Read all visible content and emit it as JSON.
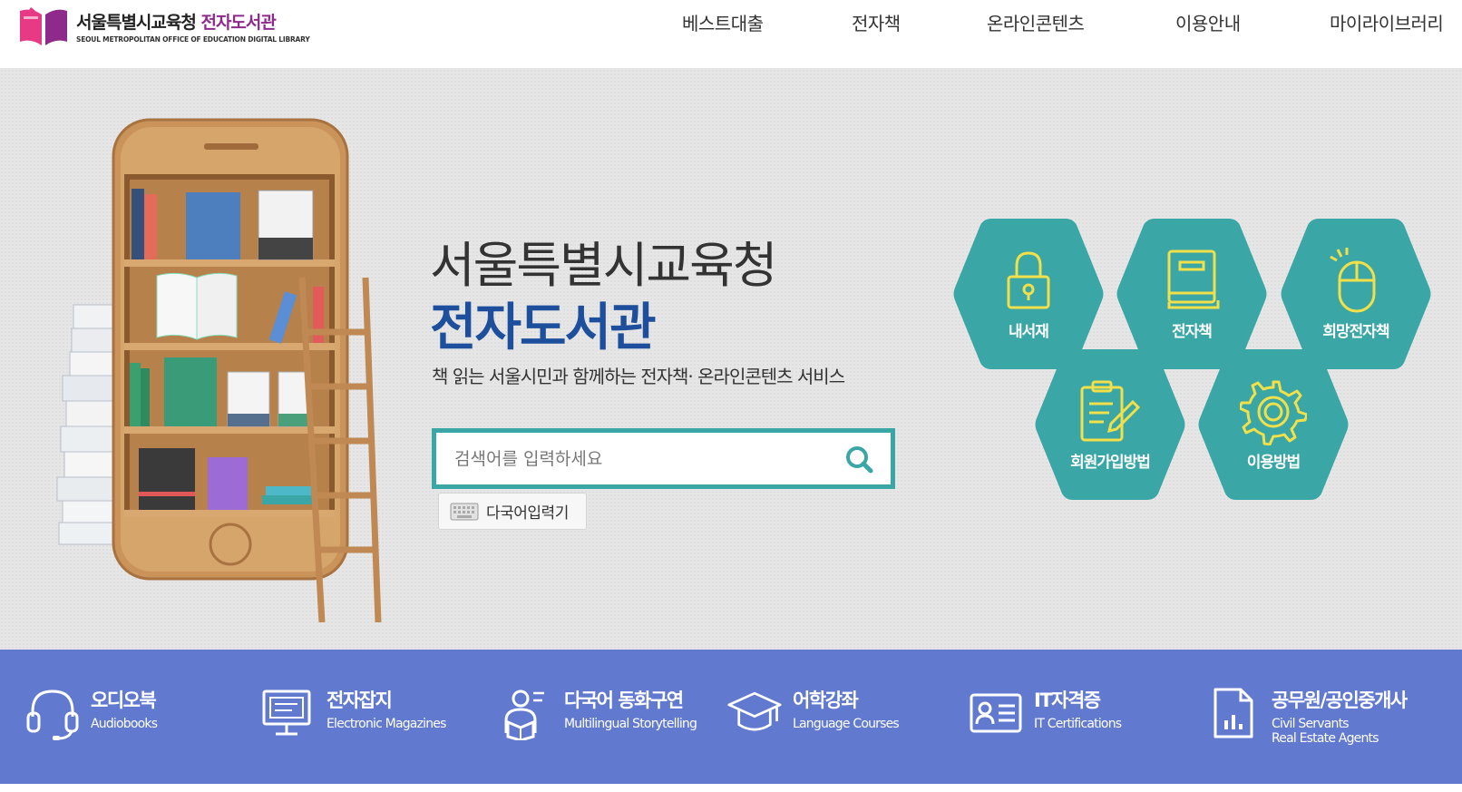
{
  "header": {
    "logo_title_main": "서울특별시교육청",
    "logo_title_accent": "전자도서관",
    "logo_subtitle": "SEOUL METROPOLITAN OFFICE OF EDUCATION DIGITAL LIBRARY",
    "nav": [
      "베스트대출",
      "전자책",
      "온라인콘텐츠",
      "이용안내",
      "마이라이브러리"
    ]
  },
  "hero": {
    "title_line1": "서울특별시교육청",
    "title_line2": "전자도서관",
    "subtitle": "책 읽는 서울시민과 함께하는 전자책· 온라인콘텐츠 서비스",
    "search_placeholder": "검색어를 입력하세요",
    "ime_label": "다국어입력기"
  },
  "quick_menu": [
    {
      "label": "내서재",
      "icon": "lock-icon"
    },
    {
      "label": "전자책",
      "icon": "book-icon"
    },
    {
      "label": "희망전자책",
      "icon": "mouse-icon"
    },
    {
      "label": "회원가입방법",
      "icon": "clipboard-pen-icon"
    },
    {
      "label": "이용방법",
      "icon": "gear-icon"
    }
  ],
  "categories": [
    {
      "title": "오디오북",
      "en": "Audiobooks",
      "icon": "headphones-icon"
    },
    {
      "title": "전자잡지",
      "en": "Electronic Magazines",
      "icon": "monitor-icon"
    },
    {
      "title": "다국어 동화구연",
      "en": "Multilingual Storytelling",
      "icon": "storyteller-icon"
    },
    {
      "title": "어학강좌",
      "en": "Language Courses",
      "icon": "graduation-cap-icon"
    },
    {
      "title": "IT자격증",
      "en": "IT Certifications",
      "icon": "id-card-icon"
    },
    {
      "title": "공무원/공인중개사",
      "en": "Civil Servants",
      "en2": "Real Estate Agents",
      "icon": "document-chart-icon"
    }
  ],
  "colors": {
    "accent_teal": "#3aa6a6",
    "title_blue": "#1e4f9c",
    "bar_blue": "#6179cf",
    "hex_icon_yellow": "#f2e04a",
    "logo_magenta": "#8e2a8c"
  }
}
